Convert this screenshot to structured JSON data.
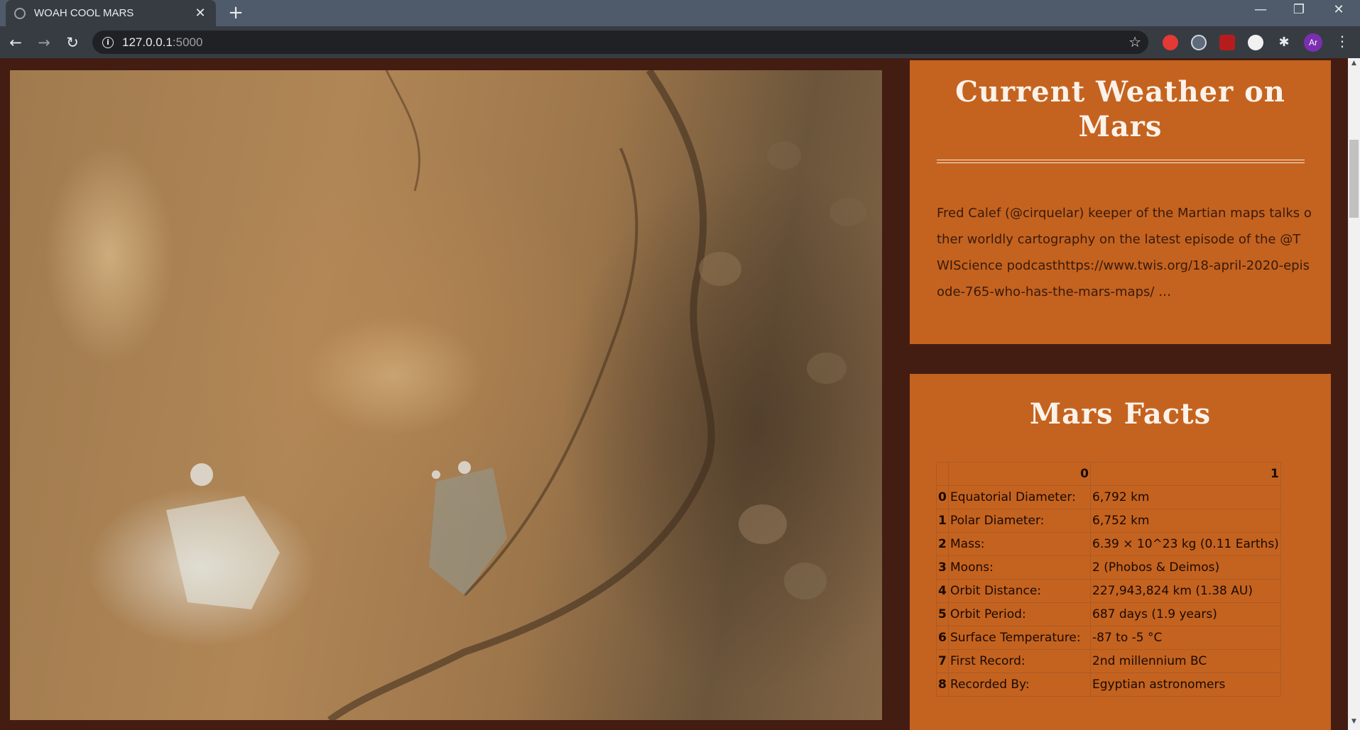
{
  "browser": {
    "tab_title": "WOAH COOL MARS",
    "close_glyph": "✕",
    "new_tab_glyph": "+",
    "url_host": "127.0.0.1",
    "url_port": ":5000",
    "profile_initials": "Ar",
    "extensions": [
      "adblock-icon",
      "eyes-extension-icon",
      "ublock-icon",
      "globe-extension-icon",
      "puzzle-icon"
    ]
  },
  "weather": {
    "title": "Current Weather on Mars",
    "tweet": "Fred Calef (@cirquelar) keeper of the Martian maps talks other worldly cartography on the latest episode of the @TWIScience podcasthttps://www.twis.org/18-april-2020-episode-765-who-has-the-mars-maps/ …"
  },
  "facts": {
    "title": "Mars Facts",
    "header": [
      "",
      "0",
      "1"
    ],
    "rows": [
      {
        "idx": "0",
        "label": "Equatorial Diameter:",
        "value": "6,792 km"
      },
      {
        "idx": "1",
        "label": "Polar Diameter:",
        "value": "6,752 km"
      },
      {
        "idx": "2",
        "label": "Mass:",
        "value": "6.39 × 10^23 kg (0.11 Earths)"
      },
      {
        "idx": "3",
        "label": "Moons:",
        "value": "2 (Phobos & Deimos)"
      },
      {
        "idx": "4",
        "label": "Orbit Distance:",
        "value": "227,943,824 km (1.38 AU)"
      },
      {
        "idx": "5",
        "label": "Orbit Period:",
        "value": "687 days (1.9 years)"
      },
      {
        "idx": "6",
        "label": "Surface Temperature:",
        "value": "-87 to -5 °C"
      },
      {
        "idx": "7",
        "label": "First Record:",
        "value": "2nd millennium BC"
      },
      {
        "idx": "8",
        "label": "Recorded By:",
        "value": "Egyptian astronomers"
      }
    ]
  },
  "colors": {
    "page_bg": "#431d12",
    "panel_bg": "#c4631f",
    "panel_text": "#3a1a0c",
    "title_text": "#fbf2ea"
  }
}
